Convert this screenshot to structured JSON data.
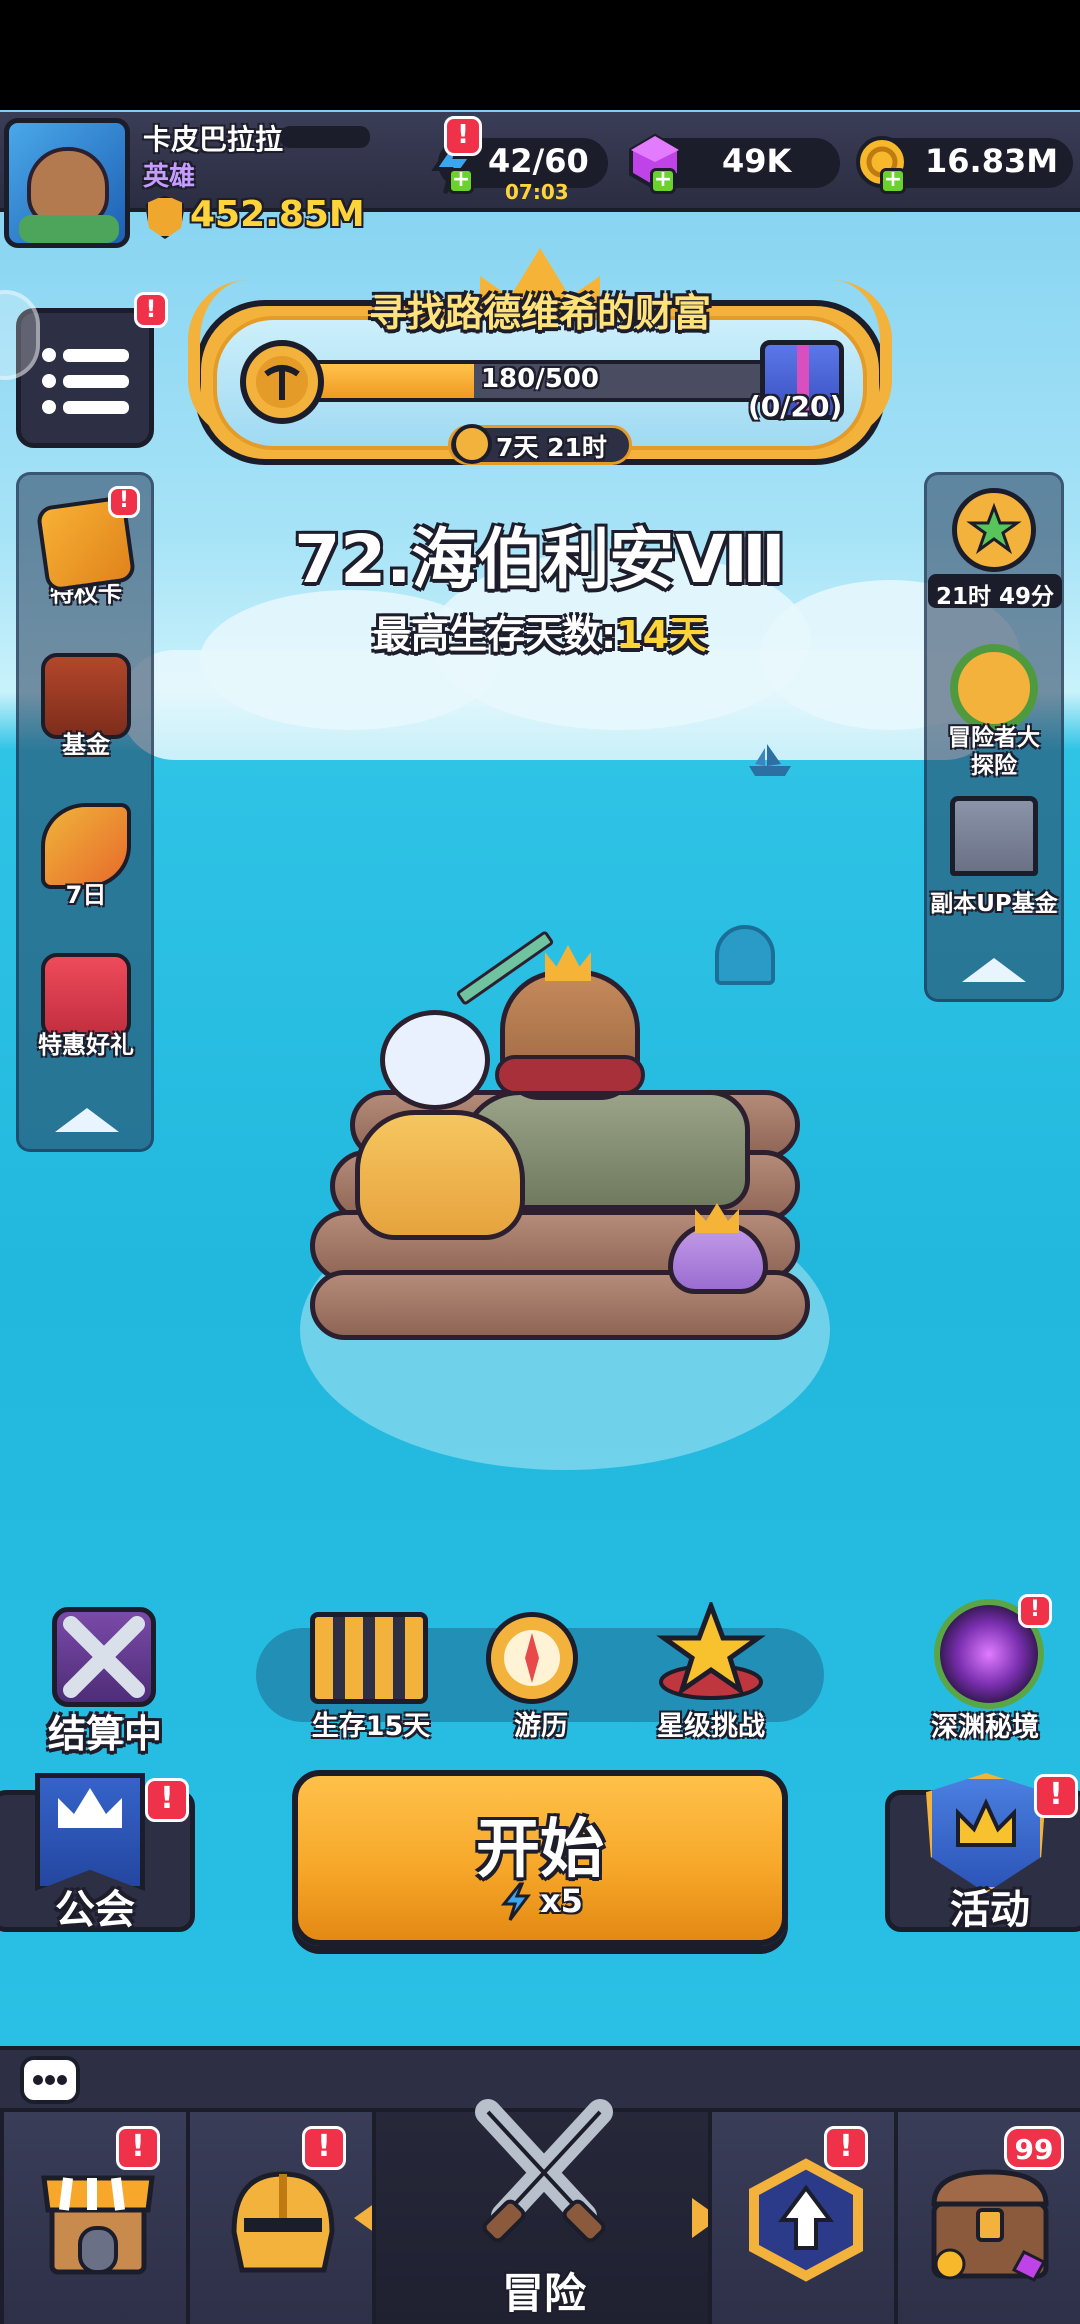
{
  "player": {
    "name": "卡皮巴拉拉",
    "rank": "英雄",
    "power": "452.85M"
  },
  "resources": {
    "energy": "42/60",
    "energy_timer": "07:03",
    "gems": "49K",
    "gold": "16.83M",
    "badge": "!"
  },
  "event": {
    "title": "寻找路德维希的财富",
    "progress_text": "180/500",
    "progress_value": 0.36,
    "reward_count": "(0/20)",
    "timer": "7天 21时"
  },
  "stage": {
    "title": "72.海伯利安Ⅷ",
    "record_label": "最高生存天数:",
    "record_value": "14天"
  },
  "left_panel": {
    "items": [
      {
        "label": "特权卡",
        "icon": "privilege-card-icon"
      },
      {
        "label": "基金",
        "icon": "fund-chart-icon"
      },
      {
        "label": "7日",
        "icon": "party-popper-icon"
      },
      {
        "label": "特惠好礼",
        "icon": "gift-box-icon"
      }
    ]
  },
  "right_panel": {
    "items": [
      {
        "label": "21时 49分",
        "icon": "star-coin-icon"
      },
      {
        "label": "冒险者大探险",
        "label_line1": "冒险者大",
        "label_line2": "探险",
        "icon": "compass-wreath-icon"
      },
      {
        "label": "副本UP基金",
        "icon": "castle-arrow-icon"
      }
    ]
  },
  "actions": {
    "settle": "结算中",
    "survive": "生存15天",
    "travel": "游历",
    "star_challenge": "星级挑战",
    "abyss": "深渊秘境",
    "guild": "公会",
    "activity": "活动",
    "start": "开始",
    "start_cost": "x5"
  },
  "bottom_nav": {
    "adventure": "冒险",
    "chest_count": "99"
  },
  "colors": {
    "start_button": "#f7a82a",
    "progress_fill": "#f5a52a",
    "badge_red": "#f0314a",
    "highlight_yellow": "#ffd43a"
  }
}
